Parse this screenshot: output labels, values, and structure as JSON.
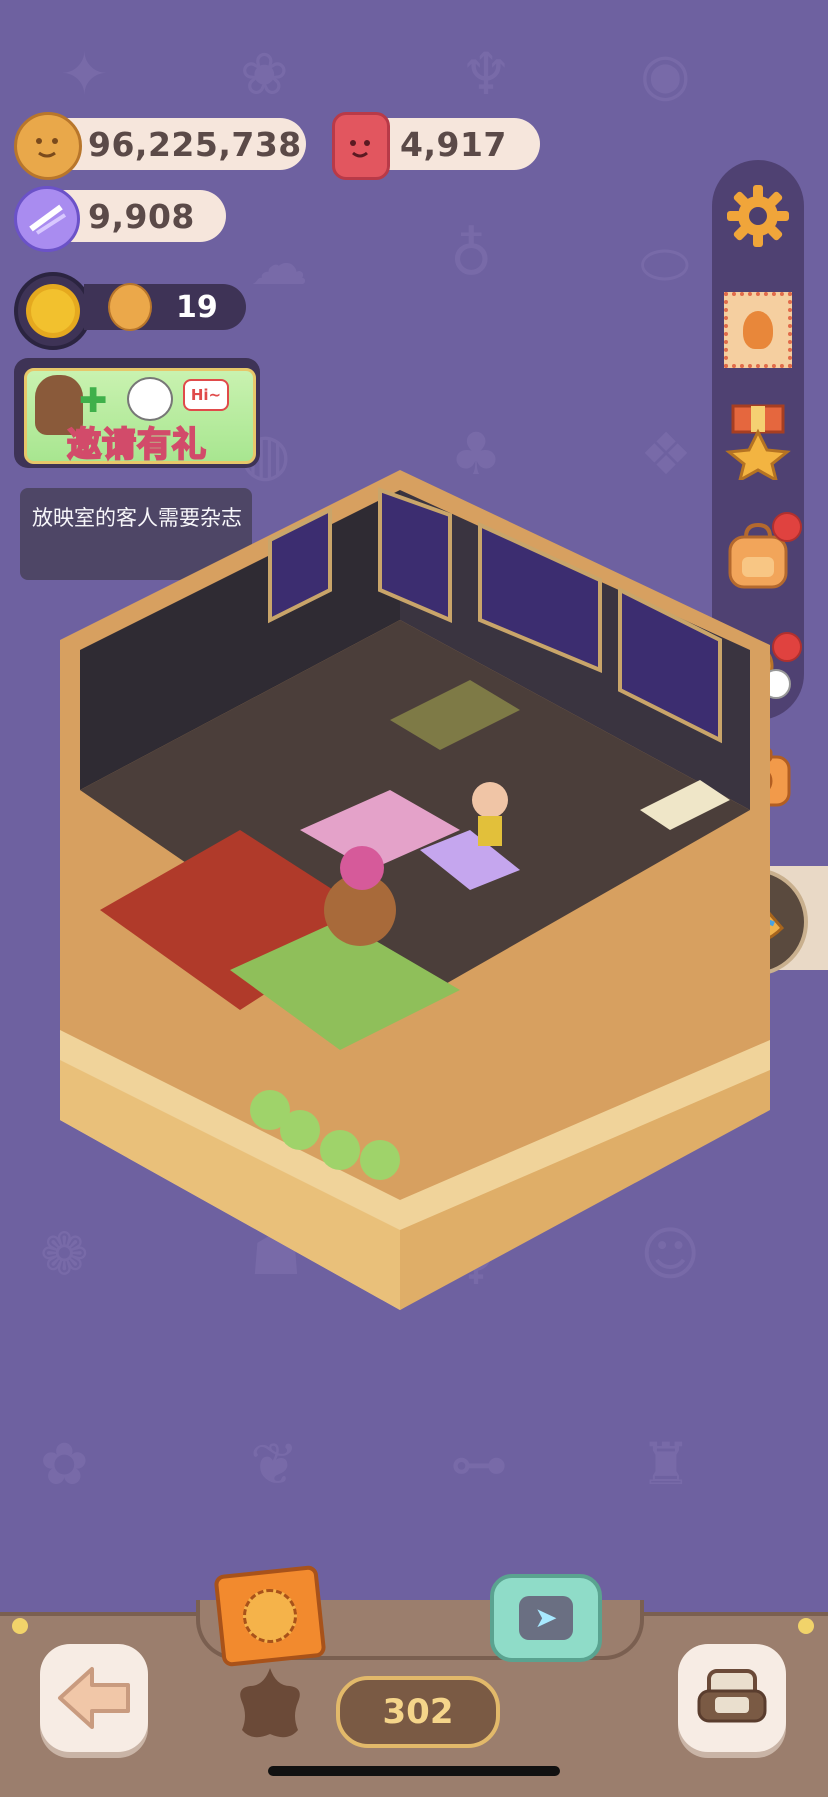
{
  "currencies": {
    "cookies": "96,225,738",
    "gems": "4,917",
    "candy": "9,908",
    "cookie_count": "19"
  },
  "event_banner": {
    "title": "邀请有礼",
    "bubble": "Hi~"
  },
  "hint_text": "放映室的客人需要杂志",
  "level_value": "302",
  "icons": {
    "settings": "gear-icon",
    "character": "stamp-icon",
    "rank": "medal-icon",
    "bag": "backpack-icon",
    "friends": "friends-icon",
    "camera": "camera-icon",
    "crepe": "crepe-icon",
    "back": "back-arrow-icon",
    "furniture": "sofa-icon",
    "album": "album-icon",
    "send": "paper-plane-icon",
    "star": "star-icon",
    "sun": "sun-icon"
  },
  "colors": {
    "background": "#6e61a0",
    "pill": "#f6e6dc",
    "sidebar": "#4c3f6e",
    "bottom_bar": "#9b7e6d",
    "notification": "#e0423f"
  }
}
